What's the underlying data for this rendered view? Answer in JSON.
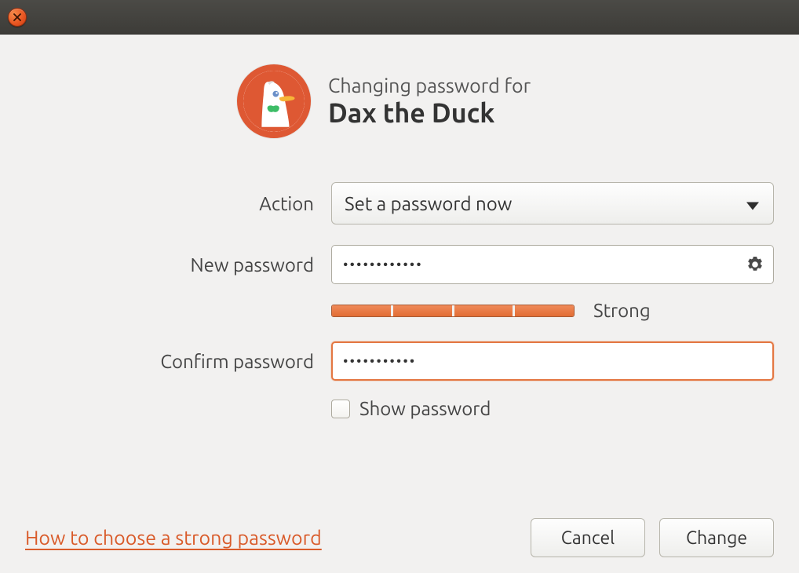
{
  "header": {
    "subtitle": "Changing password for",
    "title": "Dax the Duck"
  },
  "form": {
    "action_label": "Action",
    "action_value": "Set a password now",
    "new_password_label": "New password",
    "new_password_value": "••••••••••••",
    "strength_label": "Strong",
    "confirm_password_label": "Confirm password",
    "confirm_password_value": "•••••••••••",
    "show_password_label": "Show password",
    "show_password_checked": false
  },
  "footer": {
    "help_link": "How to choose a strong password",
    "cancel": "Cancel",
    "change": "Change"
  },
  "colors": {
    "accent": "#e95420",
    "focus": "#e47742"
  }
}
